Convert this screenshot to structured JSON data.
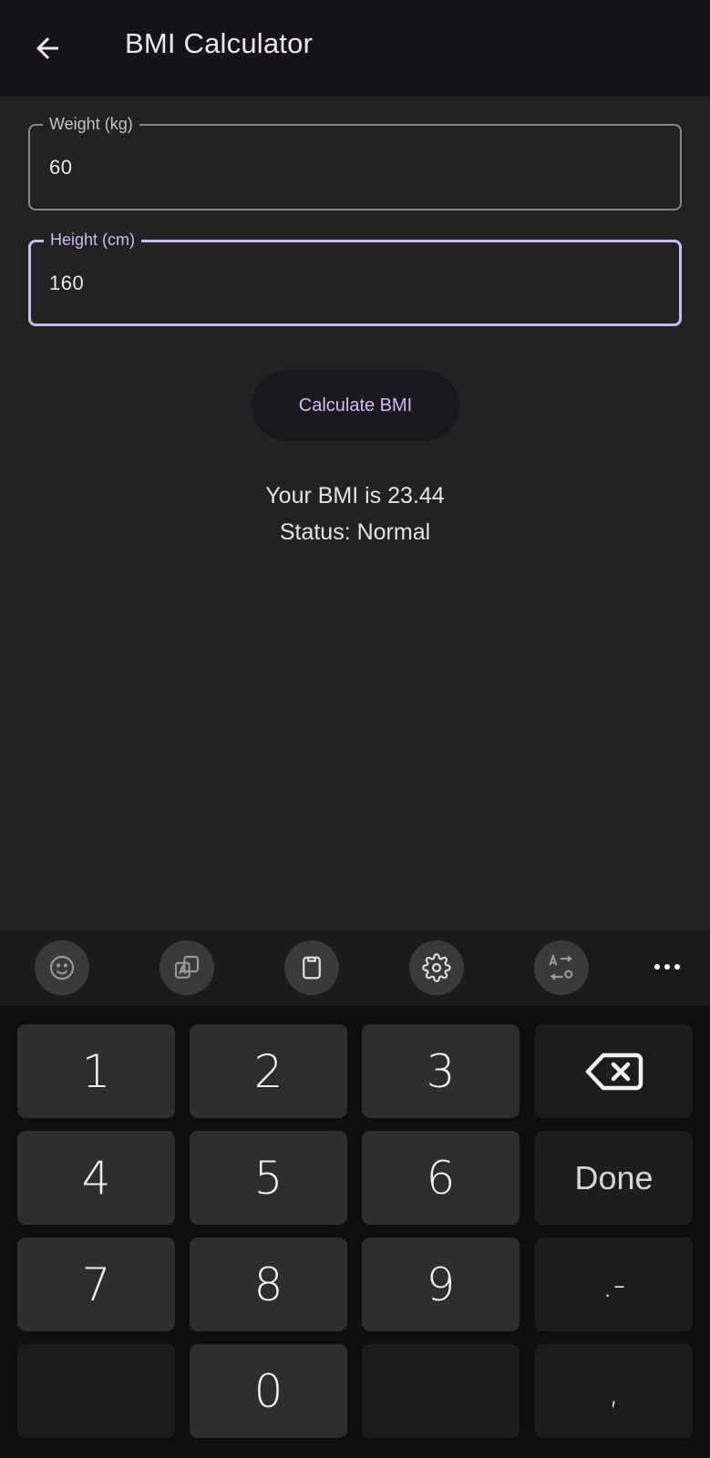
{
  "app_bar": {
    "title": "BMI Calculator",
    "back_icon": "arrow-left-icon"
  },
  "form": {
    "weight": {
      "label": "Weight (kg)",
      "value": "60"
    },
    "height": {
      "label": "Height (cm)",
      "value": "160",
      "focused": true
    }
  },
  "action": {
    "label": "Calculate BMI"
  },
  "result": {
    "bmi_text": "Your BMI is 23.44",
    "status_text": "Status: Normal"
  },
  "keyboard_toolbar": {
    "icons": [
      "emoji-icon",
      "translate-icon",
      "clipboard-icon",
      "settings-icon",
      "text-conversion-icon",
      "more-icon"
    ]
  },
  "keyboard": {
    "rows": [
      [
        "1",
        "2",
        "3",
        "⌫"
      ],
      [
        "4",
        "5",
        "6",
        "Done"
      ],
      [
        "7",
        "8",
        "9",
        ".-"
      ],
      [
        "",
        "0",
        "",
        ","
      ]
    ]
  },
  "colors": {
    "accent": "#cdb9f5",
    "button_text": "#d2bcfa",
    "app_bar_bg": "#16131b",
    "surface": "#222222"
  }
}
